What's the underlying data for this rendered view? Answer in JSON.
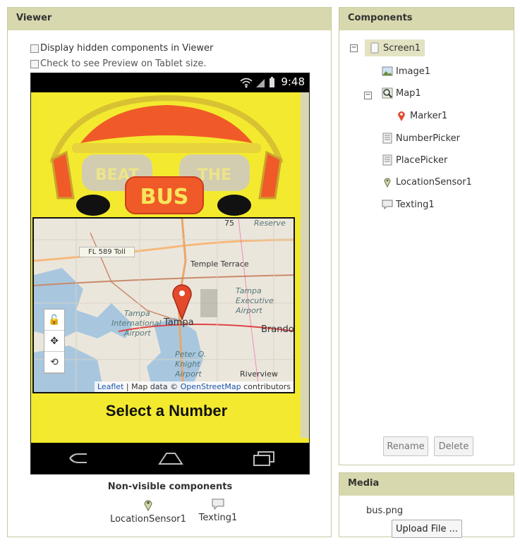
{
  "viewer": {
    "title": "Viewer",
    "display_hidden_label": "Display hidden components in Viewer",
    "tablet_preview_label": "Check to see Preview on Tablet size."
  },
  "phone": {
    "status_time": "9:48",
    "bus_text_beat": "BEAT",
    "bus_text_the": "THE",
    "bus_text_bus": "BUS",
    "map": {
      "labels": {
        "toll": "FL 589 Toll",
        "temple_terrace": "Temple Terrace",
        "reserve": "Reserve",
        "tampa_exec_1": "Tampa",
        "tampa_exec_2": "Executive",
        "tampa_exec_3": "Airport",
        "tampa_intl_1": "Tampa",
        "tampa_intl_2": "International",
        "tampa_intl_3": "Airport",
        "tampa": "Tampa",
        "brandon": "Brando",
        "peter_1": "Peter O.",
        "peter_2": "Knight",
        "peter_3": "Airport",
        "riverview": "Riverview",
        "route": "75"
      },
      "attribution_leaflet": "Leaflet",
      "attribution_mid": " | Map data © ",
      "attribution_osm": "OpenStreetMap",
      "attribution_end": " contributors"
    },
    "select_label": "Select a Number"
  },
  "non_visible": {
    "title": "Non-visible components",
    "items": [
      "LocationSensor1",
      "Texting1"
    ]
  },
  "components": {
    "title": "Components",
    "tree": [
      "Screen1",
      "Image1",
      "Map1",
      "Marker1",
      "NumberPicker",
      "PlacePicker",
      "LocationSensor1",
      "Texting1"
    ],
    "rename_label": "Rename",
    "delete_label": "Delete"
  },
  "media": {
    "title": "Media",
    "file": "bus.png",
    "upload_label": "Upload File ..."
  },
  "colors": {
    "panel_header": "#d8d8ae",
    "phone_background": "#f3ea2f",
    "bus_orange": "#f05a28",
    "marker_red": "#e24a2b"
  },
  "icons": {
    "tree_collapse": "minus-box-icon",
    "screen": "screen-icon",
    "image": "image-icon",
    "map": "map-icon",
    "marker": "marker-icon",
    "picker": "list-picker-icon",
    "location": "location-pin-icon",
    "texting": "speech-bubble-icon"
  }
}
